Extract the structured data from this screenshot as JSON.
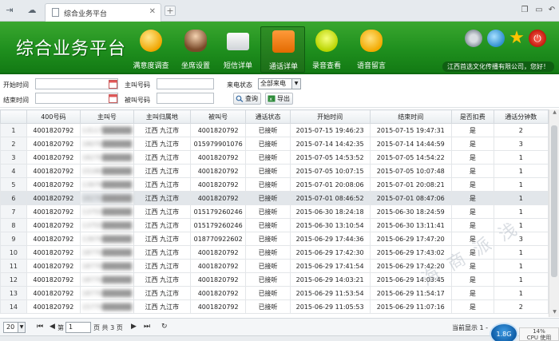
{
  "tab": {
    "title": "综合业务平台"
  },
  "header": {
    "brand": "综合业务平台",
    "nav": [
      {
        "label": "满意度调查",
        "icon": "satisfaction-medal-icon"
      },
      {
        "label": "坐席设置",
        "icon": "agents-icon"
      },
      {
        "label": "短信详单",
        "icon": "envelope-icon"
      },
      {
        "label": "通话详单",
        "icon": "phone-list-icon",
        "active": true
      },
      {
        "label": "录音查看",
        "icon": "microphone-icon"
      },
      {
        "label": "语音留言",
        "icon": "voice-message-icon"
      }
    ],
    "company": "江西首选文化传播有限公司，您好！",
    "accent": "#1f8f1e"
  },
  "filter": {
    "start_time_label": "开始时间",
    "end_time_label": "结束时间",
    "caller_label": "主叫号码",
    "callee_label": "被叫号码",
    "status_label": "来电状态",
    "status_value": "全部来电",
    "query_label": "查询",
    "export_label": "导出"
  },
  "table": {
    "columns": [
      "",
      "400号码",
      "主叫号",
      "主叫归属地",
      "被叫号",
      "通话状态",
      "开始时间",
      "结束时间",
      "是否扣费",
      "通话分钟数"
    ],
    "rows": [
      [
        "1",
        "4001820792",
        "13117██████",
        "江西 九江市",
        "4001820792",
        "已接听",
        "2015-07-15 19:46:23",
        "2015-07-15 19:47:31",
        "是",
        "2"
      ],
      [
        "2",
        "4001820792",
        "18070██████",
        "江西 九江市",
        "015979901076",
        "已接听",
        "2015-07-14 14:42:35",
        "2015-07-14 14:44:59",
        "是",
        "3"
      ],
      [
        "3",
        "4001820792",
        "18270██████",
        "江西 九江市",
        "4001820792",
        "已接听",
        "2015-07-05 14:53:52",
        "2015-07-05 14:54:22",
        "是",
        "1"
      ],
      [
        "4",
        "4001820792",
        "15180██████",
        "江西 九江市",
        "4001820792",
        "已接听",
        "2015-07-05 10:07:15",
        "2015-07-05 10:07:48",
        "是",
        "1"
      ],
      [
        "5",
        "4001820792",
        "13979██████",
        "江西 九江市",
        "4001820792",
        "已接听",
        "2015-07-01 20:08:06",
        "2015-07-01 20:08:21",
        "是",
        "1"
      ],
      [
        "6",
        "4001820792",
        "18270██████",
        "江西 九江市",
        "4001820792",
        "已接听",
        "2015-07-01 08:46:52",
        "2015-07-01 08:47:06",
        "是",
        "1"
      ],
      [
        "7",
        "4001820792",
        "13755██████",
        "江西 九江市",
        "015179260246",
        "已接听",
        "2015-06-30 18:24:18",
        "2015-06-30 18:24:59",
        "是",
        "1"
      ],
      [
        "8",
        "4001820792",
        "13755██████",
        "江西 九江市",
        "015179260246",
        "已接听",
        "2015-06-30 13:10:54",
        "2015-06-30 13:11:41",
        "是",
        "1"
      ],
      [
        "9",
        "4001820792",
        "13979██████",
        "江西 九江市",
        "018770922602",
        "已接听",
        "2015-06-29 17:44:36",
        "2015-06-29 17:47:20",
        "是",
        "3"
      ],
      [
        "10",
        "4001820792",
        "18770██████",
        "江西 九江市",
        "4001820792",
        "已接听",
        "2015-06-29 17:42:30",
        "2015-06-29 17:43:02",
        "是",
        "1"
      ],
      [
        "11",
        "4001820792",
        "18770██████",
        "江西 九江市",
        "4001820792",
        "已接听",
        "2015-06-29 17:41:54",
        "2015-06-29 17:42:20",
        "是",
        "1"
      ],
      [
        "12",
        "4001820792",
        "18770██████",
        "江西 九江市",
        "4001820792",
        "已接听",
        "2015-06-29 14:03:21",
        "2015-06-29 14:03:45",
        "是",
        "1"
      ],
      [
        "13",
        "4001820792",
        "18770██████",
        "江西 九江市",
        "4001820792",
        "已接听",
        "2015-06-29 11:53:54",
        "2015-06-29 11:54:17",
        "是",
        "1"
      ],
      [
        "14",
        "4001820792",
        "15779██████",
        "江西 九江市",
        "4001820792",
        "已接听",
        "2015-06-29 11:05:53",
        "2015-06-29 11:07:16",
        "是",
        "2"
      ]
    ],
    "selected_row": 6
  },
  "pager": {
    "page_size": "20",
    "page_prefix": "第",
    "page_value": "1",
    "page_suffix": "页 共 3 页",
    "info": "当前显示 1 - "
  },
  "status": {
    "speed": "1.8G",
    "cpu": "14%",
    "cpu_label": "CPU 使用"
  },
  "watermark": "海 商 派 浅"
}
